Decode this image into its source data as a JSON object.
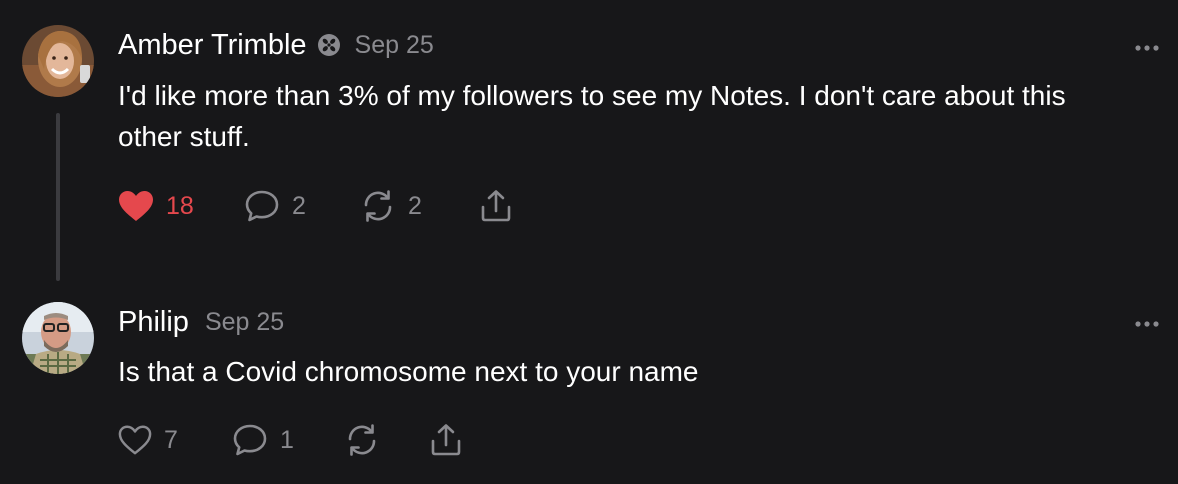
{
  "notes": [
    {
      "author": "Amber Trimble",
      "badge_icon": "covid-badge-icon",
      "date": "Sep 25",
      "text": "I'd like more than 3% of my followers to see my Notes. I don't care about this other stuff.",
      "liked": true,
      "likes": "18",
      "comments": "2",
      "restacks": "2"
    },
    {
      "author": "Philip",
      "date": "Sep 25",
      "text": "Is that a Covid chromosome next to your name",
      "liked": false,
      "likes": "7",
      "comments": "1",
      "restacks": ""
    }
  ],
  "icons": {
    "like": "heart-icon",
    "comment": "comment-bubble-icon",
    "restack": "restack-icon",
    "share": "share-icon",
    "more": "more-options-icon"
  },
  "colors": {
    "background": "#171719",
    "text": "#ffffff",
    "muted": "#8a8a8f",
    "like_active": "#e5484d",
    "thread_line": "#3b3b3f"
  }
}
